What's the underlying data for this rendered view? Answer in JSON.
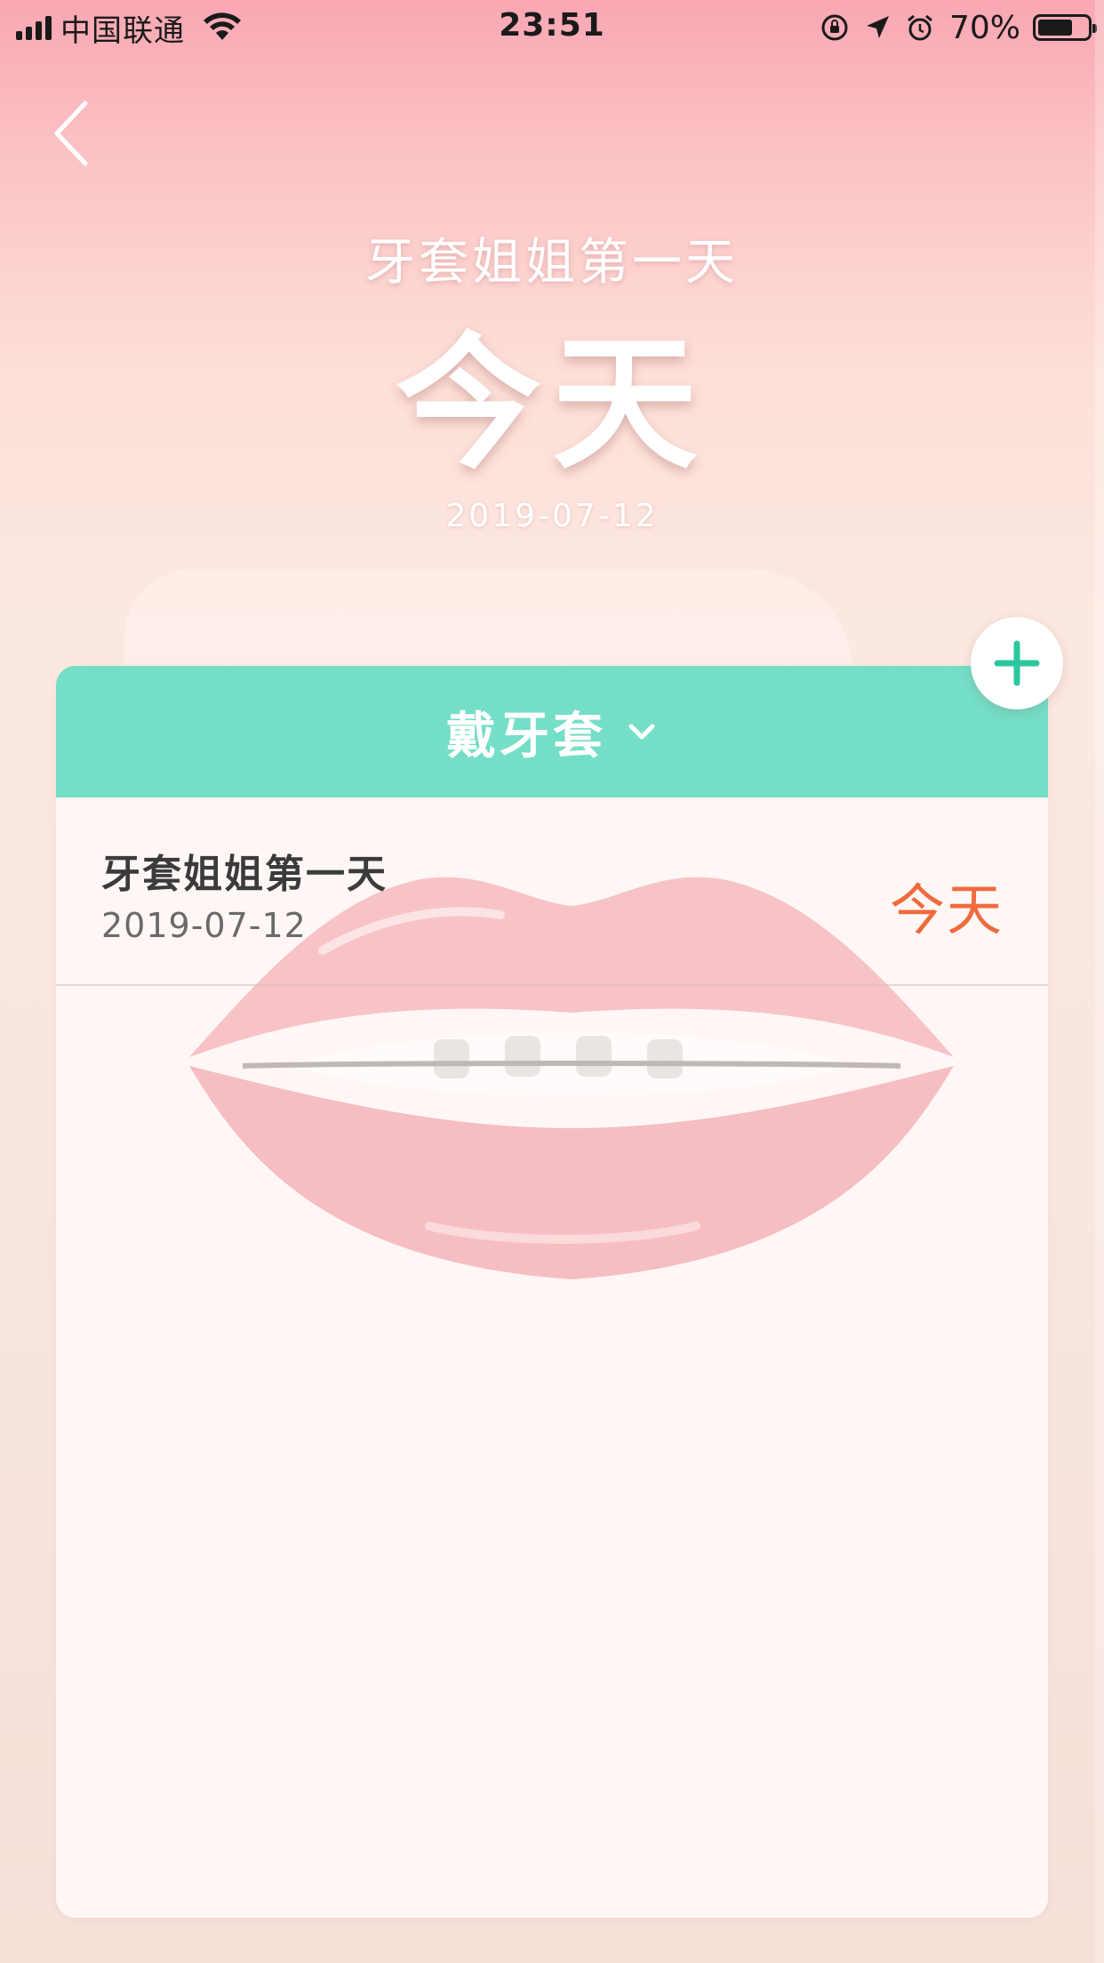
{
  "status_bar": {
    "carrier": "中国联通",
    "time": "23:51",
    "battery_percent": "70%",
    "battery_level": 0.7,
    "icons": [
      "signal-icon",
      "wifi-icon",
      "orientation-lock-icon",
      "location-icon",
      "alarm-icon",
      "battery-icon"
    ]
  },
  "header": {
    "back_icon": "chevron-left-icon",
    "subtitle": "牙套姐姐第一天",
    "days": "今天",
    "date": "2019-07-12"
  },
  "card": {
    "category_label": "戴牙套",
    "category_icon": "chevron-down-icon",
    "header_color": "#75dec6",
    "events": [
      {
        "title": "牙套姐姐第一天",
        "date": "2019-07-12",
        "days": "今天"
      }
    ]
  },
  "add_button": {
    "icon": "plus-icon",
    "color": "#2dc79e"
  },
  "colors": {
    "accent": "#75dec6",
    "days_highlight": "#f06a3e",
    "background_top": "#f9a7b3",
    "background_bottom": "#f6e0d8"
  }
}
